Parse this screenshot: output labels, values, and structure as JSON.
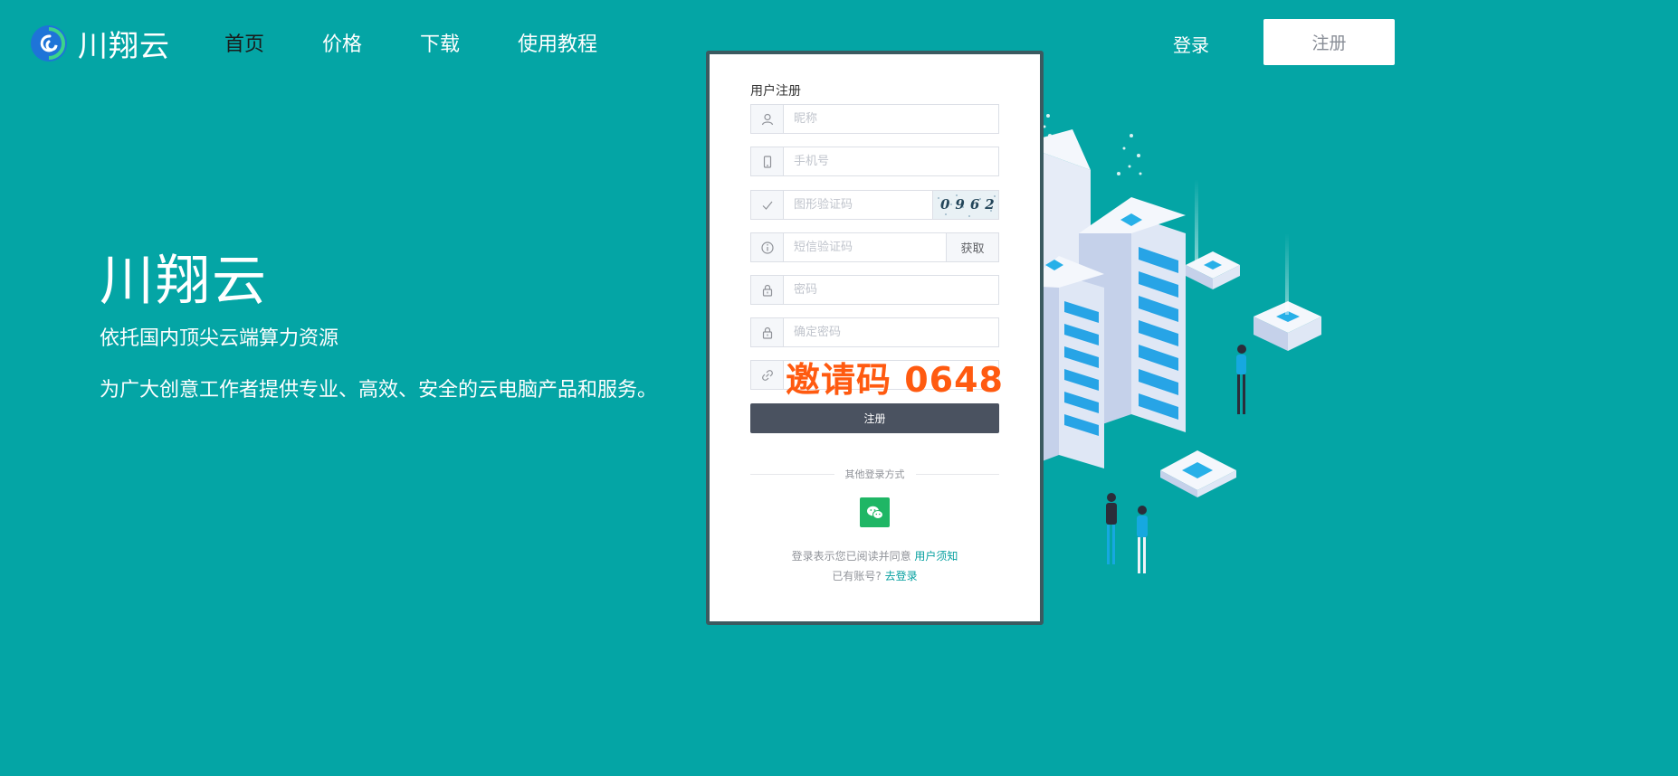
{
  "header": {
    "logo_text": "川翔云",
    "nav": [
      {
        "label": "首页",
        "active": true
      },
      {
        "label": "价格",
        "active": false
      },
      {
        "label": "下载",
        "active": false
      },
      {
        "label": "使用教程",
        "active": false
      }
    ],
    "login_label": "登录",
    "register_label": "注册"
  },
  "hero": {
    "title": "川翔云",
    "line1": "依托国内顶尖云端算力资源",
    "line2": "为广大创意工作者提供专业、高效、安全的云电脑产品和服务。"
  },
  "form": {
    "title": "用户注册",
    "nickname_placeholder": "昵称",
    "phone_placeholder": "手机号",
    "captcha_placeholder": "图形验证码",
    "captcha_text": "0962",
    "sms_placeholder": "短信验证码",
    "sms_button": "获取",
    "password_placeholder": "密码",
    "confirm_placeholder": "确定密码",
    "invite_overlay": "邀请码 0648",
    "submit_label": "注册",
    "other_login": "其他登录方式",
    "agree_text": "登录表示您已阅读并同意",
    "agree_link": "用户须知",
    "has_account_text": "已有账号?",
    "has_account_link": "去登录"
  },
  "colors": {
    "background": "#04a5a5",
    "card_border": "#3b5a60",
    "submit": "#4a5260",
    "wechat": "#1fb665",
    "invite": "#ff5a10",
    "link": "#06a0a0"
  },
  "icons": [
    "logo-icon",
    "user-icon",
    "phone-icon",
    "check-icon",
    "info-icon",
    "lock-icon",
    "link-icon",
    "wechat-icon"
  ]
}
